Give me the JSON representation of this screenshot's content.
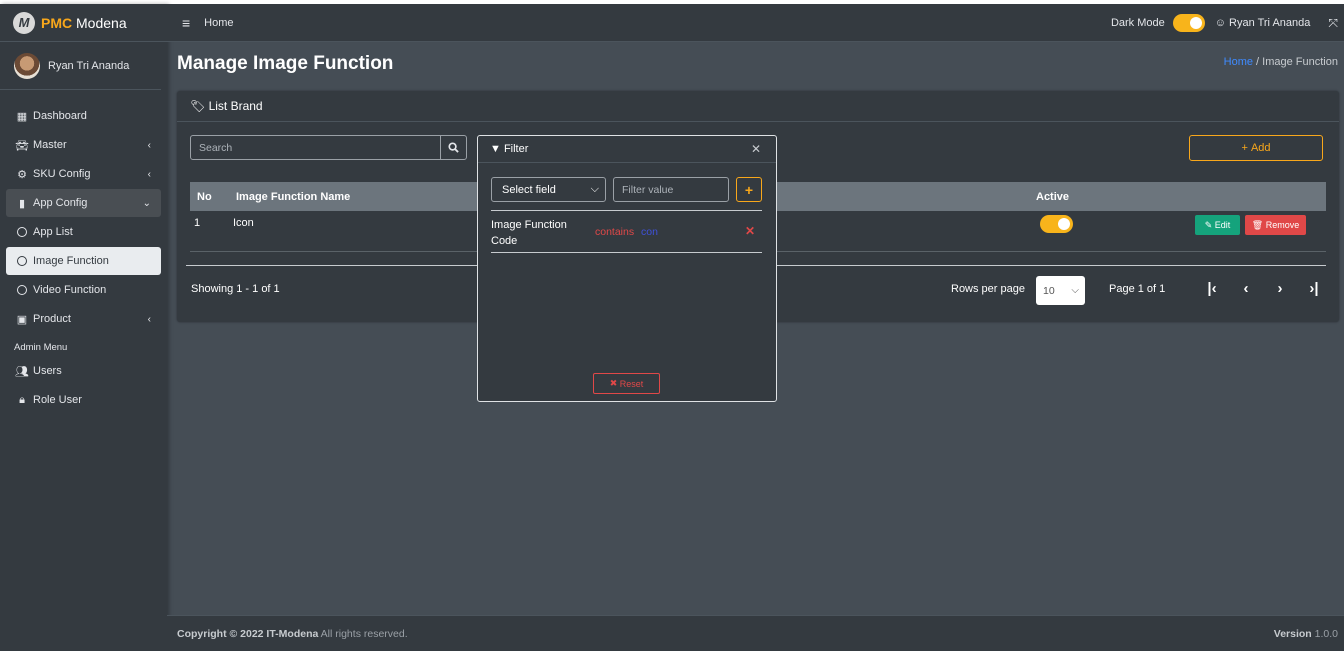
{
  "brand": {
    "prefix": "PMC",
    "name": "Modena",
    "logo_letter": "M"
  },
  "user": {
    "name": "Ryan Tri Ananda"
  },
  "sidebar": {
    "items": [
      {
        "label": "Dashboard",
        "icon": "th-icon"
      },
      {
        "label": "Master",
        "icon": "car-icon",
        "arrow": "‹"
      },
      {
        "label": "SKU Config",
        "icon": "gear-icon",
        "arrow": "‹"
      },
      {
        "label": "App Config",
        "icon": "mobile-icon",
        "arrow": "⌄"
      },
      {
        "label": "App List",
        "icon": "circle-icon"
      },
      {
        "label": "Image Function",
        "icon": "circle-icon"
      },
      {
        "label": "Video Function",
        "icon": "circle-icon"
      },
      {
        "label": "Product",
        "icon": "box-icon",
        "arrow": "‹"
      }
    ],
    "admin_header": "Admin Menu",
    "admin_items": [
      {
        "label": "Users",
        "icon": "users-icon"
      },
      {
        "label": "Role User",
        "icon": "lock-icon"
      }
    ]
  },
  "header": {
    "home": "Home",
    "dark_mode_label": "Dark Mode",
    "dark_mode_on": true
  },
  "page": {
    "title": "Manage Image Function",
    "breadcrumb_home": "Home",
    "breadcrumb_sep": "/",
    "breadcrumb_current": "Image Function"
  },
  "card": {
    "title": "List Brand",
    "search_placeholder": "Search",
    "add_label": "Add",
    "columns": [
      "No",
      "Image Function Name",
      "Active"
    ],
    "rows": [
      {
        "no": "1",
        "name": "Icon",
        "active": true,
        "edit": "Edit",
        "remove": "Remove"
      }
    ],
    "showing": "Showing 1 - 1 of 1",
    "rows_per_page_label": "Rows per page",
    "rows_per_page": "10",
    "page_info": "Page 1 of 1"
  },
  "filter": {
    "title": "Filter",
    "select_placeholder": "Select field",
    "value_placeholder": "Filter value",
    "criteria": [
      {
        "field": "Image Function Code",
        "operator": "contains",
        "value": "con"
      }
    ],
    "reset_label": "Reset"
  },
  "footer": {
    "copyright_bold": "Copyright © 2022 IT-Modena",
    "copyright_rest": " All rights reserved.",
    "version_label": "Version",
    "version_value": " 1.0.0"
  },
  "colors": {
    "accent": "#f8a71b",
    "danger": "#e04848",
    "success": "#15a37c",
    "link": "#3f8bff"
  }
}
